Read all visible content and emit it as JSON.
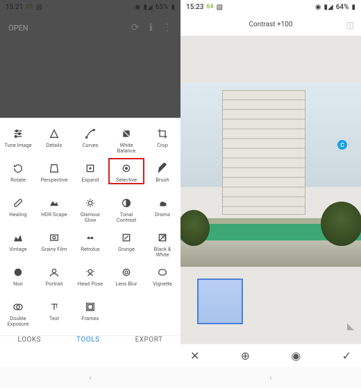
{
  "left": {
    "status": {
      "time": "15:21",
      "temp": "65",
      "battery": "65%"
    },
    "open_label": "OPEN",
    "tools": [
      {
        "label": "Tune Image",
        "icon": "sliders",
        "name": "tool-tune-image"
      },
      {
        "label": "Details",
        "icon": "triangle",
        "name": "tool-details"
      },
      {
        "label": "Curves",
        "icon": "curves",
        "name": "tool-curves"
      },
      {
        "label": "White\nBalance",
        "icon": "wb",
        "name": "tool-white-balance"
      },
      {
        "label": "Crop",
        "icon": "crop",
        "name": "tool-crop"
      },
      {
        "label": "Rotate",
        "icon": "rotate",
        "name": "tool-rotate"
      },
      {
        "label": "Perspective",
        "icon": "perspective",
        "name": "tool-perspective"
      },
      {
        "label": "Expand",
        "icon": "expand",
        "name": "tool-expand"
      },
      {
        "label": "Selective",
        "icon": "target",
        "name": "tool-selective",
        "highlight": true
      },
      {
        "label": "Brush",
        "icon": "brush",
        "name": "tool-brush"
      },
      {
        "label": "Healing",
        "icon": "bandage",
        "name": "tool-healing"
      },
      {
        "label": "HDR Scape",
        "icon": "hdr",
        "name": "tool-hdr-scape"
      },
      {
        "label": "Glamour\nGlow",
        "icon": "glow",
        "name": "tool-glamour-glow"
      },
      {
        "label": "Tonal\nContrast",
        "icon": "tonal",
        "name": "tool-tonal-contrast"
      },
      {
        "label": "Drama",
        "icon": "drama",
        "name": "tool-drama"
      },
      {
        "label": "Vintage",
        "icon": "vintage",
        "name": "tool-vintage"
      },
      {
        "label": "Grainy Film",
        "icon": "film",
        "name": "tool-grainy-film"
      },
      {
        "label": "Retrolux",
        "icon": "retro",
        "name": "tool-retrolux"
      },
      {
        "label": "Grunge",
        "icon": "grunge",
        "name": "tool-grunge"
      },
      {
        "label": "Black &\nWhite",
        "icon": "bw",
        "name": "tool-black-white"
      },
      {
        "label": "Noir",
        "icon": "noir",
        "name": "tool-noir"
      },
      {
        "label": "Portrait",
        "icon": "portrait",
        "name": "tool-portrait"
      },
      {
        "label": "Head Pose",
        "icon": "headpose",
        "name": "tool-head-pose"
      },
      {
        "label": "Lens Blur",
        "icon": "lensblur",
        "name": "tool-lens-blur"
      },
      {
        "label": "Vignette",
        "icon": "vignette",
        "name": "tool-vignette"
      },
      {
        "label": "Double\nExposure",
        "icon": "double",
        "name": "tool-double-exposure"
      },
      {
        "label": "Text",
        "icon": "text",
        "name": "tool-text"
      },
      {
        "label": "Frames",
        "icon": "frames",
        "name": "tool-frames"
      }
    ],
    "tabs": {
      "looks": "LOOKS",
      "tools": "TOOLS",
      "export": "EXPORT"
    }
  },
  "right": {
    "status": {
      "time": "15:23",
      "temp": "64",
      "battery": "64%"
    },
    "header_label": "Contrast +100",
    "selective_marker": "C"
  }
}
